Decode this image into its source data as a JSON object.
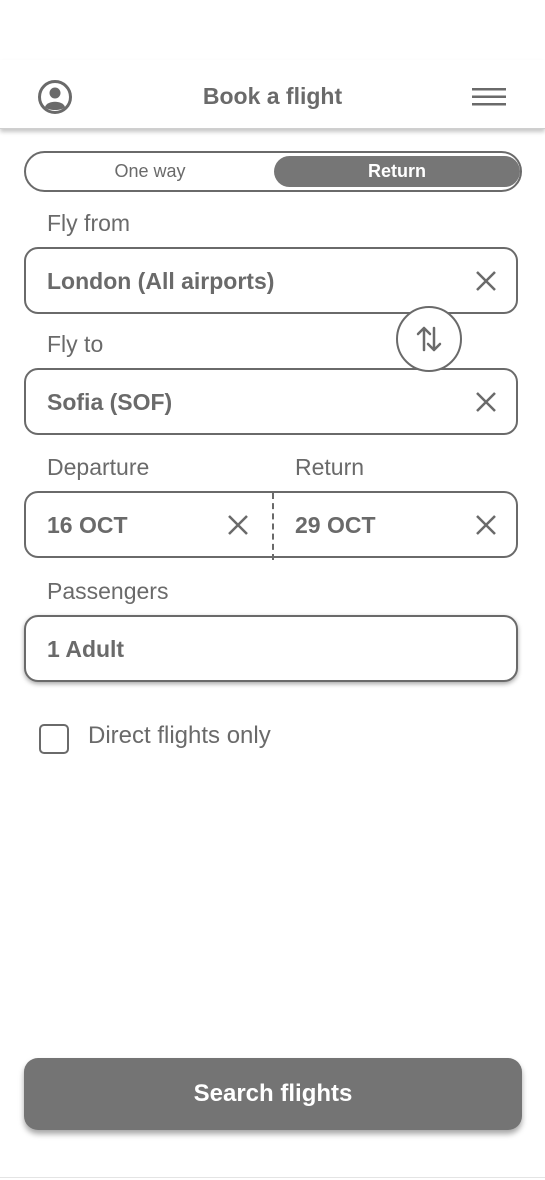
{
  "header": {
    "title": "Book a flight",
    "profile_icon": "user-circle-icon",
    "menu_icon": "hamburger-menu-icon"
  },
  "trip_type": {
    "options": [
      "One way",
      "Return"
    ],
    "selected": "Return"
  },
  "fly_from": {
    "label": "Fly from",
    "value": "London (All airports)",
    "clear_icon": "close-icon"
  },
  "swap": {
    "icon": "swap-vertical-arrows-icon"
  },
  "fly_to": {
    "label": "Fly to",
    "value": "Sofia (SOF)",
    "clear_icon": "close-icon"
  },
  "dates": {
    "departure": {
      "label": "Departure",
      "value": "16 OCT",
      "clear_icon": "close-icon"
    },
    "return": {
      "label": "Return",
      "value": "29 OCT",
      "clear_icon": "close-icon"
    }
  },
  "passengers": {
    "label": "Passengers",
    "value": "1 Adult"
  },
  "direct_flights": {
    "label": "Direct flights only",
    "checked": false
  },
  "search_button": {
    "label": "Search flights"
  },
  "colors": {
    "text": "#6a6a6a",
    "accent": "#767676",
    "background": "#ffffff"
  }
}
